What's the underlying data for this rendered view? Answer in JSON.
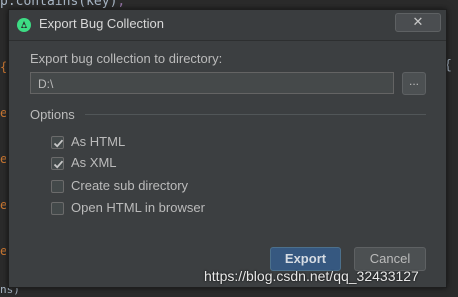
{
  "editor": {
    "code_fragment": "p.contains(key)",
    "code_suffix": ";",
    "right_brace": "{",
    "bottom_fragment": "ns)"
  },
  "dialog": {
    "title": "Export Bug Collection",
    "close_label": "✕",
    "directory_label": "Export bug collection to directory:",
    "directory_value": "D:\\",
    "browse_label": "...",
    "options_label": "Options",
    "options": [
      {
        "label": "As HTML",
        "checked": true
      },
      {
        "label": "As XML",
        "checked": true
      },
      {
        "label": "Create sub directory",
        "checked": false
      },
      {
        "label": "Open HTML in browser",
        "checked": false
      }
    ],
    "export_label": "Export",
    "cancel_label": "Cancel"
  },
  "watermark": "https://blog.csdn.net/qq_32433127",
  "colors": {
    "dialog_bg": "#3c3f41",
    "primary_button": "#365880",
    "text": "#bbbbbb"
  }
}
